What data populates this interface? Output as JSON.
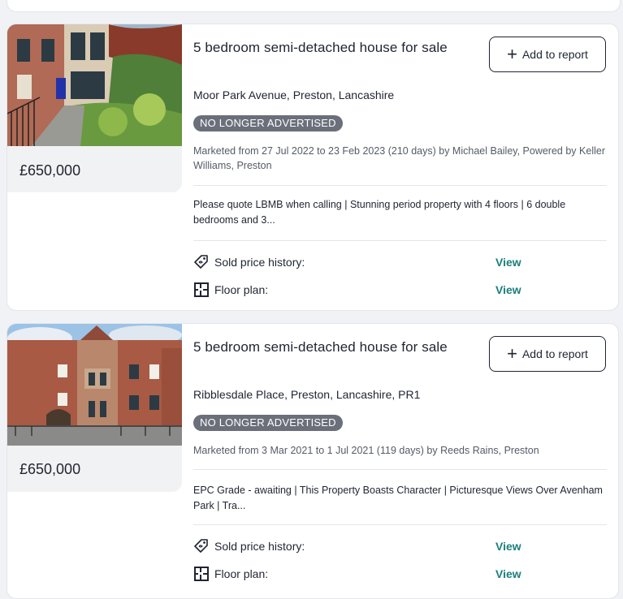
{
  "listings": [
    {
      "price": "£650,000",
      "title": "5 bedroom semi-detached house for sale",
      "add_to_report": "Add to report",
      "address": "Moor Park Avenue, Preston, Lancashire",
      "status": "NO LONGER ADVERTISED",
      "marketed": "Marketed from 27 Jul 2022 to 23 Feb 2023 (210 days) by Michael Bailey, Powered by Keller Williams, Preston",
      "description": "Please quote LBMB when calling | Stunning period property with 4 floors | 6 double bedrooms and 3...",
      "sold_price_label": "Sold price history:",
      "sold_price_link": "View",
      "floor_plan_label": "Floor plan:",
      "floor_plan_link": "View"
    },
    {
      "price": "£650,000",
      "title": "5 bedroom semi-detached house for sale",
      "add_to_report": "Add to report",
      "address": "Ribblesdale Place, Preston, Lancashire, PR1",
      "status": "NO LONGER ADVERTISED",
      "marketed": "Marketed from 3 Mar 2021 to 1 Jul 2021 (119 days) by Reeds Rains, Preston",
      "description": "EPC Grade - awaiting | This Property Boasts Character | Picturesque Views Over Avenham Park | Tra...",
      "sold_price_label": "Sold price history:",
      "sold_price_link": "View",
      "floor_plan_label": "Floor plan:",
      "floor_plan_link": "View"
    }
  ],
  "colors": {
    "link": "#1a7f7a",
    "badge_bg": "#6b6f7a",
    "price_bg": "#f1f2f4"
  },
  "icons": {
    "add": "plus-icon",
    "sold_price": "price-tag-icon",
    "floor_plan": "floor-plan-icon"
  }
}
